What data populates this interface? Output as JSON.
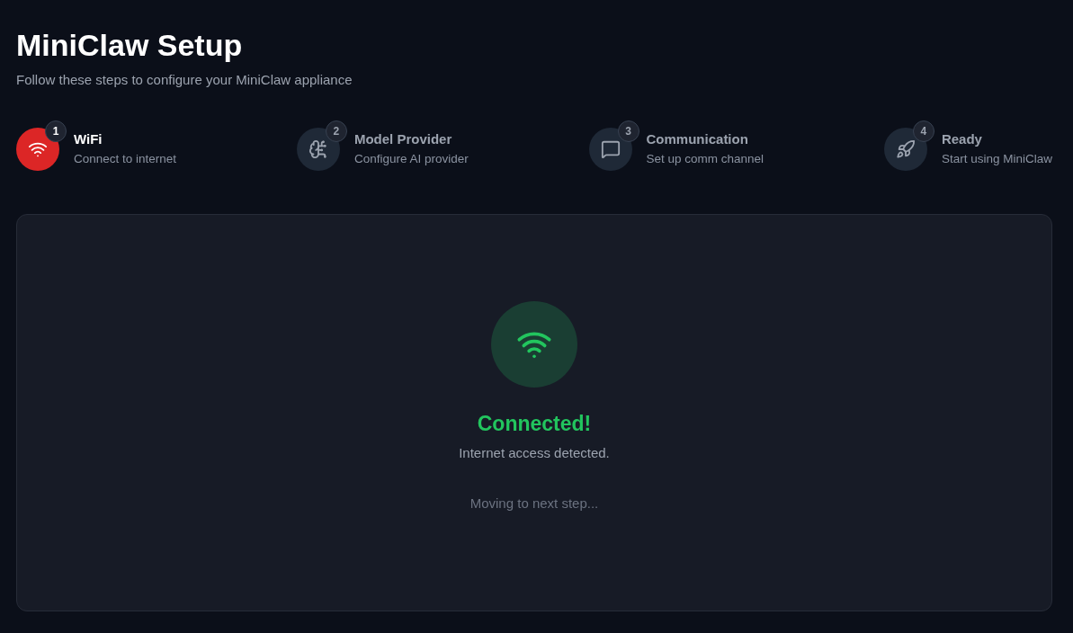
{
  "header": {
    "title": "MiniClaw Setup",
    "subtitle": "Follow these steps to configure your MiniClaw appliance"
  },
  "steps": [
    {
      "number": "1",
      "title": "WiFi",
      "description": "Connect to internet",
      "selected": true
    },
    {
      "number": "2",
      "title": "Model Provider",
      "description": "Configure AI provider",
      "selected": false
    },
    {
      "number": "3",
      "title": "Communication",
      "description": "Set up comm channel",
      "selected": false
    },
    {
      "number": "4",
      "title": "Ready",
      "description": "Start using MiniClaw",
      "selected": false
    }
  ],
  "status": {
    "connected": true,
    "title": "Connected!",
    "message": "Internet access detected.",
    "note": "Moving to next step..."
  }
}
